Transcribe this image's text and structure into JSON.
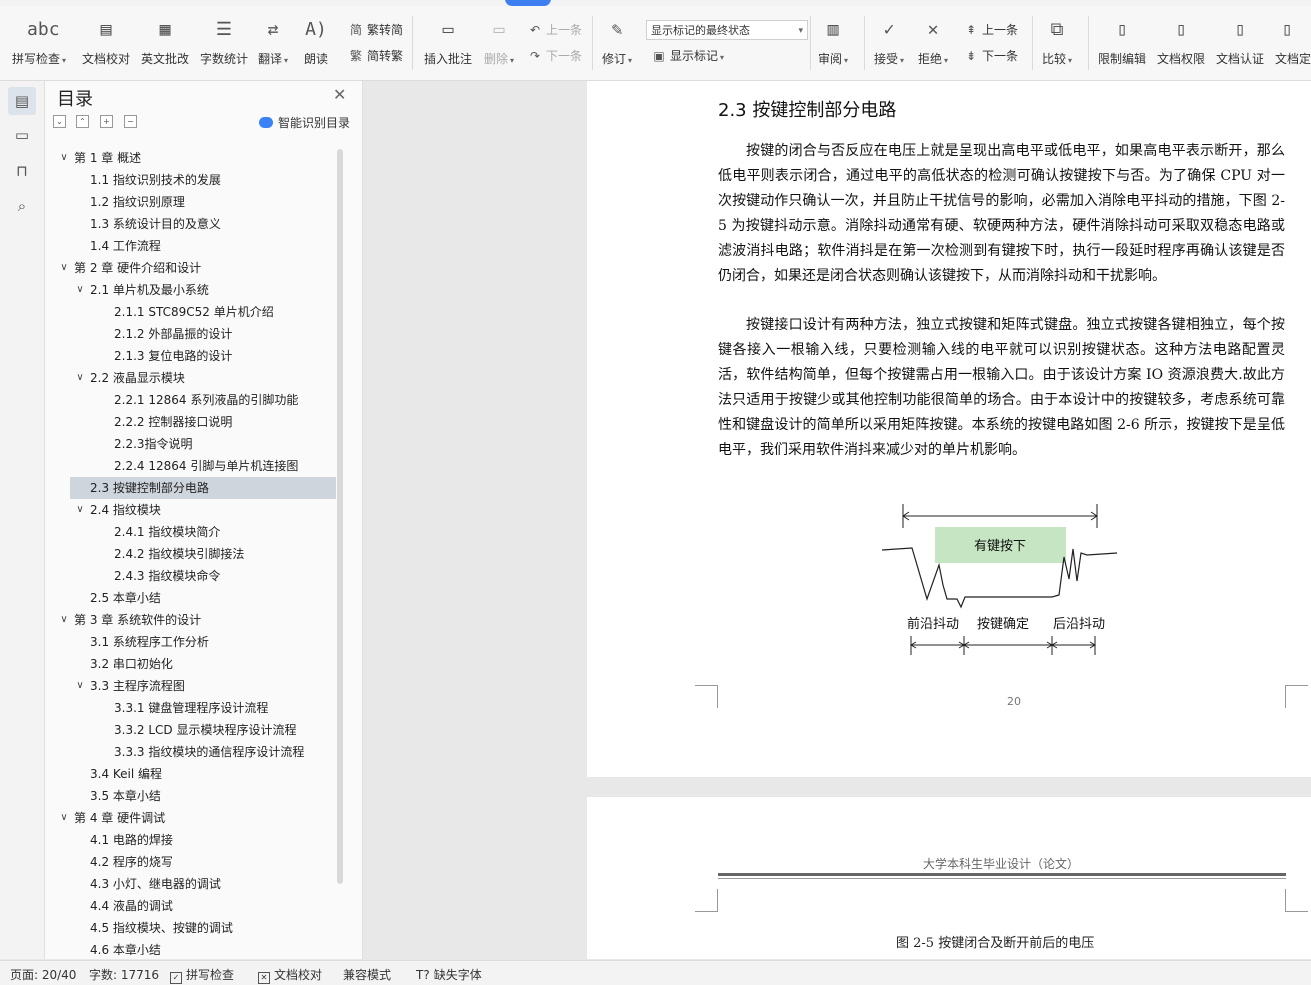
{
  "ribbon": {
    "spell_check": "拼写检查",
    "doc_proof": "文档校对",
    "en_correct": "英文批改",
    "word_count": "字数统计",
    "translate": "翻译",
    "read_aloud": "朗读",
    "trad_to_simp": "繁转简",
    "simp_to_trad": "简转繁",
    "insert_comment": "插入批注",
    "delete": "删除",
    "prev_comment": "上一条",
    "next_comment": "下一条",
    "track_changes": "修订",
    "markup_state": "显示标记的最终状态",
    "show_markup": "显示标记",
    "review": "审阅",
    "accept": "接受",
    "reject": "拒绝",
    "prev_change": "上一条",
    "next_change": "下一条",
    "compare": "比较",
    "restrict_edit": "限制编辑",
    "doc_permission": "文档权限",
    "doc_certify": "文档认证",
    "doc_finalize": "文档定"
  },
  "toc": {
    "title": "目录",
    "smart_label": "智能识别目录",
    "items": [
      {
        "label": "第 1 章  概述",
        "level": 1,
        "expanded": true
      },
      {
        "label": "1.1  指纹识别技术的发展",
        "level": 2
      },
      {
        "label": "1.2  指纹识别原理",
        "level": 2
      },
      {
        "label": "1.3  系统设计目的及意义",
        "level": 2
      },
      {
        "label": "1.4  工作流程",
        "level": 2
      },
      {
        "label": "第 2 章  硬件介绍和设计",
        "level": 1,
        "expanded": true
      },
      {
        "label": "2.1  单片机及最小系统",
        "level": 2,
        "expanded": true
      },
      {
        "label": "2.1.1 STC89C52 单片机介绍",
        "level": 3
      },
      {
        "label": "2.1.2  外部晶振的设计",
        "level": 3
      },
      {
        "label": "2.1.3  复位电路的设计",
        "level": 3
      },
      {
        "label": "2.2  液晶显示模块",
        "level": 2,
        "expanded": true
      },
      {
        "label": "2.2.1 12864 系列液晶的引脚功能",
        "level": 3
      },
      {
        "label": "2.2.2  控制器接口说明",
        "level": 3
      },
      {
        "label": "2.2.3指令说明",
        "level": 3
      },
      {
        "label": "2.2.4 12864 引脚与单片机连接图",
        "level": 3
      },
      {
        "label": "2.3  按键控制部分电路",
        "level": 2,
        "selected": true
      },
      {
        "label": "2.4  指纹模块",
        "level": 2,
        "expanded": true
      },
      {
        "label": "2.4.1  指纹模块简介",
        "level": 3
      },
      {
        "label": "2.4.2  指纹模块引脚接法",
        "level": 3
      },
      {
        "label": "2.4.3  指纹模块命令",
        "level": 3
      },
      {
        "label": "2.5  本章小结",
        "level": 2
      },
      {
        "label": "第 3 章  系统软件的设计",
        "level": 1,
        "expanded": true
      },
      {
        "label": "3.1  系统程序工作分析",
        "level": 2
      },
      {
        "label": "3.2  串口初始化",
        "level": 2
      },
      {
        "label": "3.3  主程序流程图",
        "level": 2,
        "expanded": true
      },
      {
        "label": "3.3.1  键盘管理程序设计流程",
        "level": 3
      },
      {
        "label": "3.3.2 LCD 显示模块程序设计流程",
        "level": 3
      },
      {
        "label": "3.3.3  指纹模块的通信程序设计流程",
        "level": 3
      },
      {
        "label": "3.4 Keil 编程",
        "level": 2
      },
      {
        "label": "3.5  本章小结",
        "level": 2
      },
      {
        "label": "第 4 章  硬件调试",
        "level": 1,
        "expanded": true
      },
      {
        "label": "4.1  电路的焊接",
        "level": 2
      },
      {
        "label": "4.2  程序的烧写",
        "level": 2
      },
      {
        "label": "4.3  小灯、继电器的调试",
        "level": 2
      },
      {
        "label": "4.4  液晶的调试",
        "level": 2
      },
      {
        "label": "4.5  指纹模块、按键的调试",
        "level": 2
      },
      {
        "label": "4.6  本章小结",
        "level": 2
      }
    ]
  },
  "document": {
    "section_heading": "2.3  按键控制部分电路",
    "para1": "按键的闭合与否反应在电压上就是呈现出高电平或低电平，如果高电平表示断开，那么低电平则表示闭合，通过电平的高低状态的检测可确认按键按下与否。为了确保 CPU 对一次按键动作只确认一次，并且防止干扰信号的影响，必需加入消除电平抖动的措施，下图 2-5 为按键抖动示意。消除抖动通常有硬、软硬两种方法，硬件消除抖动可采取双稳态电路或滤波消抖电路；软件消抖是在第一次检测到有键按下时，执行一段延时程序再确认该键是否仍闭合，如果还是闭合状态则确认该键按下，从而消除抖动和干扰影响。",
    "para2": "按键接口设计有两种方法，独立式按键和矩阵式键盘。独立式按键各键相独立，每个按键各接入一根输入线，只要检测输入线的电平就可以识别按键状态。这种方法电路配置灵活，软件结构简单，但每个按键需占用一根输入口。由于该设计方案 IO 资源浪费大.故此方法只适用于按键少或其他控制功能很简单的场合。由于本设计中的按键较多，考虑系统可靠性和键盘设计的简单所以采用矩阵按键。本系统的按键电路如图 2-6 所示，按键按下是呈低电平，我们采用软件消抖来减少对的单片机影响。",
    "figure": {
      "pressed_label": "有键按下",
      "front_bounce": "前沿抖动",
      "key_confirm": "按键确定",
      "back_bounce": "后沿抖动",
      "pressed_fill": "#c6e6c3"
    },
    "page_number": "20",
    "running_header": "大学本科生毕业设计（论文）",
    "figure_caption": "图 2-5  按键闭合及断开前后的电压"
  },
  "status": {
    "page": "页面: 20/40",
    "words": "字数: 17716",
    "spell_check": "拼写检查",
    "doc_proof": "文档校对",
    "compat_mode": "兼容模式",
    "missing_fonts": "缺失字体"
  }
}
